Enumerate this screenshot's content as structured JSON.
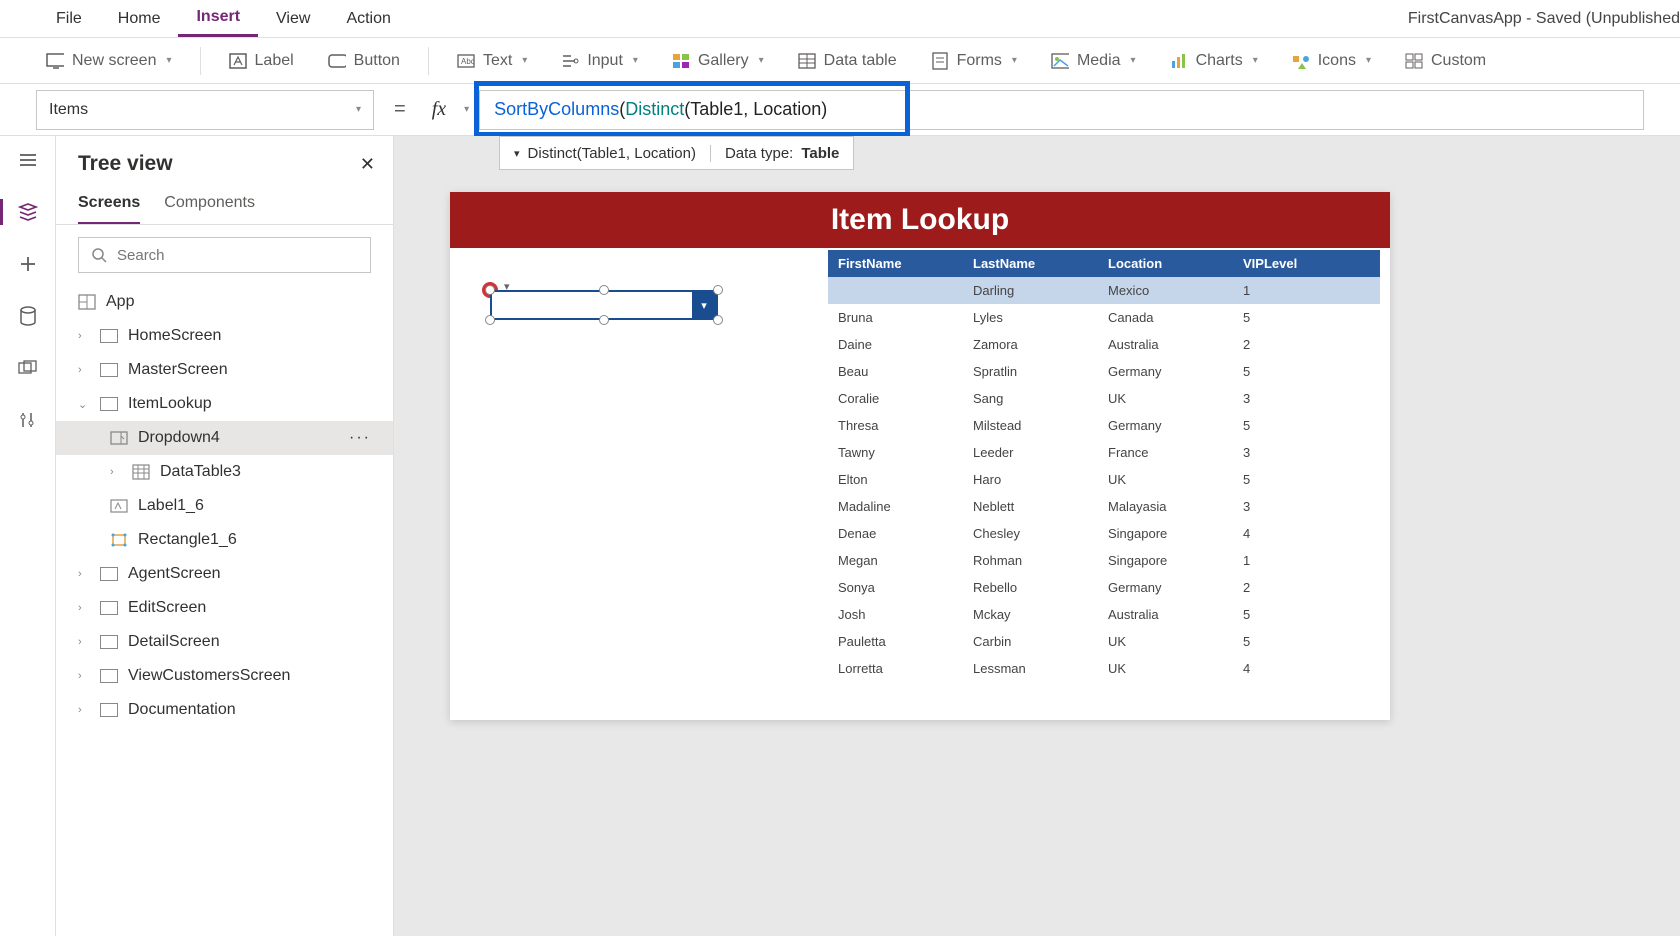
{
  "app_title": "FirstCanvasApp - Saved (Unpublished",
  "menu": {
    "file": "File",
    "home": "Home",
    "insert": "Insert",
    "view": "View",
    "action": "Action"
  },
  "ribbon": {
    "new_screen": "New screen",
    "label": "Label",
    "button": "Button",
    "text": "Text",
    "input": "Input",
    "gallery": "Gallery",
    "data_table": "Data table",
    "forms": "Forms",
    "media": "Media",
    "charts": "Charts",
    "icons": "Icons",
    "custom": "Custom"
  },
  "property_select": "Items",
  "formula": {
    "fn1": "SortByColumns",
    "fn2": "Distinct",
    "t1": "(",
    "t2": "(Table1, Location)"
  },
  "formula_result": {
    "expand": "Distinct(Table1, Location)",
    "dtype_label": "Data type: ",
    "dtype": "Table"
  },
  "tree": {
    "title": "Tree view",
    "tab_screens": "Screens",
    "tab_components": "Components",
    "search_ph": "Search",
    "app": "App",
    "items": [
      "HomeScreen",
      "MasterScreen",
      "ItemLookup",
      "Dropdown4",
      "DataTable3",
      "Label1_6",
      "Rectangle1_6",
      "AgentScreen",
      "EditScreen",
      "DetailScreen",
      "ViewCustomersScreen",
      "Documentation"
    ]
  },
  "screen": {
    "header": "Item Lookup"
  },
  "table": {
    "headers": [
      "FirstName",
      "LastName",
      "Location",
      "VIPLevel"
    ],
    "rows": [
      [
        "",
        "Darling",
        "Mexico",
        "1"
      ],
      [
        "Bruna",
        "Lyles",
        "Canada",
        "5"
      ],
      [
        "Daine",
        "Zamora",
        "Australia",
        "2"
      ],
      [
        "Beau",
        "Spratlin",
        "Germany",
        "5"
      ],
      [
        "Coralie",
        "Sang",
        "UK",
        "3"
      ],
      [
        "Thresa",
        "Milstead",
        "Germany",
        "5"
      ],
      [
        "Tawny",
        "Leeder",
        "France",
        "3"
      ],
      [
        "Elton",
        "Haro",
        "UK",
        "5"
      ],
      [
        "Madaline",
        "Neblett",
        "Malayasia",
        "3"
      ],
      [
        "Denae",
        "Chesley",
        "Singapore",
        "4"
      ],
      [
        "Megan",
        "Rohman",
        "Singapore",
        "1"
      ],
      [
        "Sonya",
        "Rebello",
        "Germany",
        "2"
      ],
      [
        "Josh",
        "Mckay",
        "Australia",
        "5"
      ],
      [
        "Pauletta",
        "Carbin",
        "UK",
        "5"
      ],
      [
        "Lorretta",
        "Lessman",
        "UK",
        "4"
      ]
    ]
  }
}
